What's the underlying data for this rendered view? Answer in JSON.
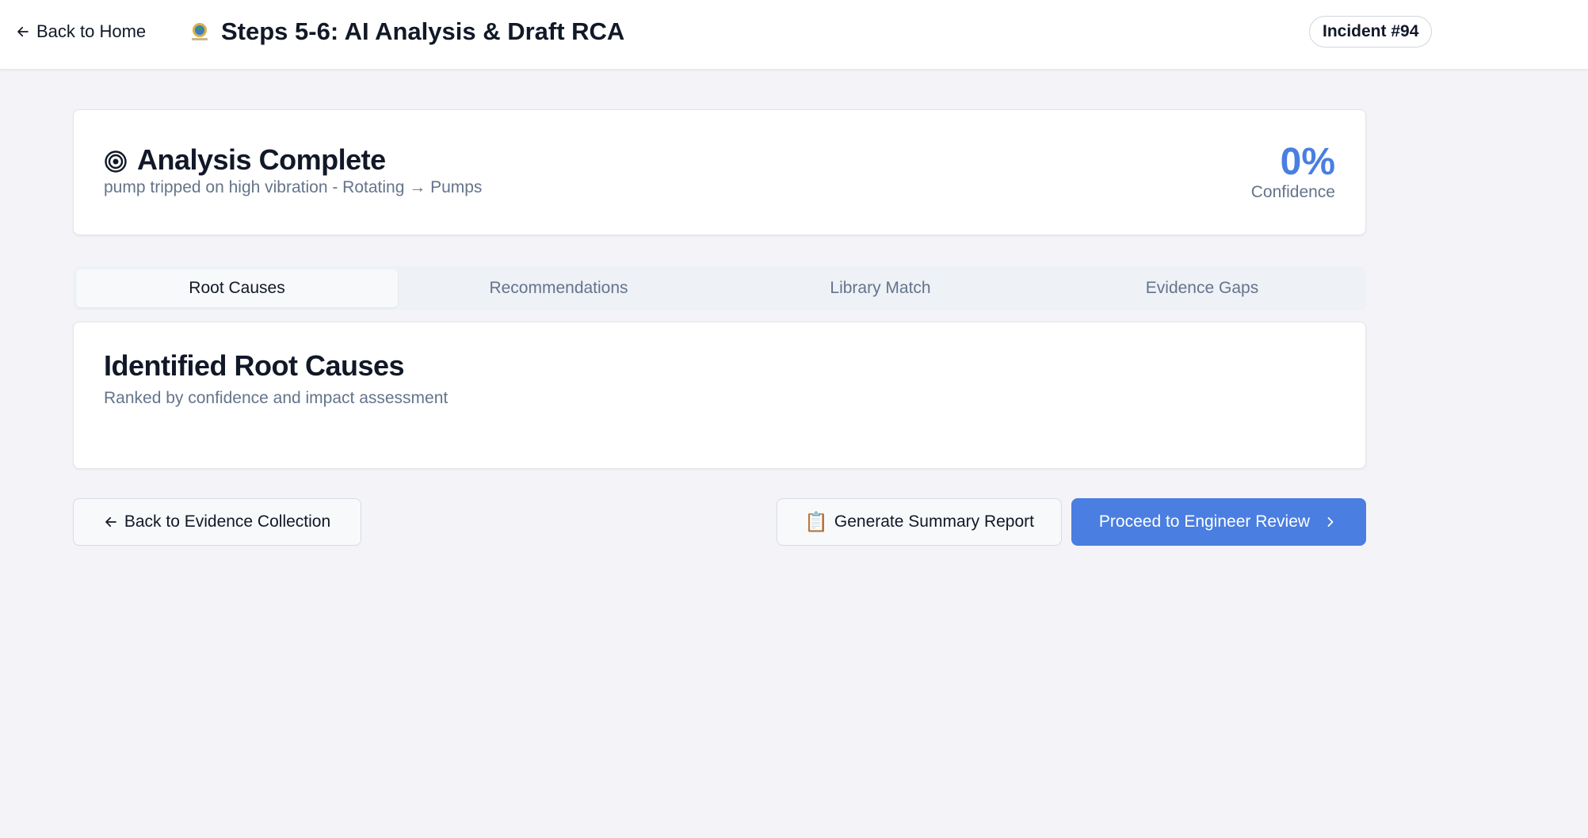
{
  "header": {
    "back_label": "Back to Home",
    "title": "Steps 5-6: AI Analysis & Draft RCA",
    "incident": "Incident #94"
  },
  "summary": {
    "title": "Analysis Complete",
    "subtitle": "pump tripped on high vibration - Rotating → Pumps",
    "confidence_value": "0%",
    "confidence_label": "Confidence"
  },
  "tabs": [
    {
      "label": "Root Causes",
      "active": true
    },
    {
      "label": "Recommendations",
      "active": false
    },
    {
      "label": "Library Match",
      "active": false
    },
    {
      "label": "Evidence Gaps",
      "active": false
    }
  ],
  "root_causes": {
    "title": "Identified Root Causes",
    "subtitle": "Ranked by confidence and impact assessment"
  },
  "actions": {
    "back_label": "Back to Evidence Collection",
    "report_icon": "📋",
    "report_label": "Generate Summary Report",
    "proceed_label": "Proceed to Engineer Review"
  },
  "colors": {
    "accent": "#4a7ee0",
    "background": "#f4f4f8",
    "muted_text": "#64748b"
  }
}
